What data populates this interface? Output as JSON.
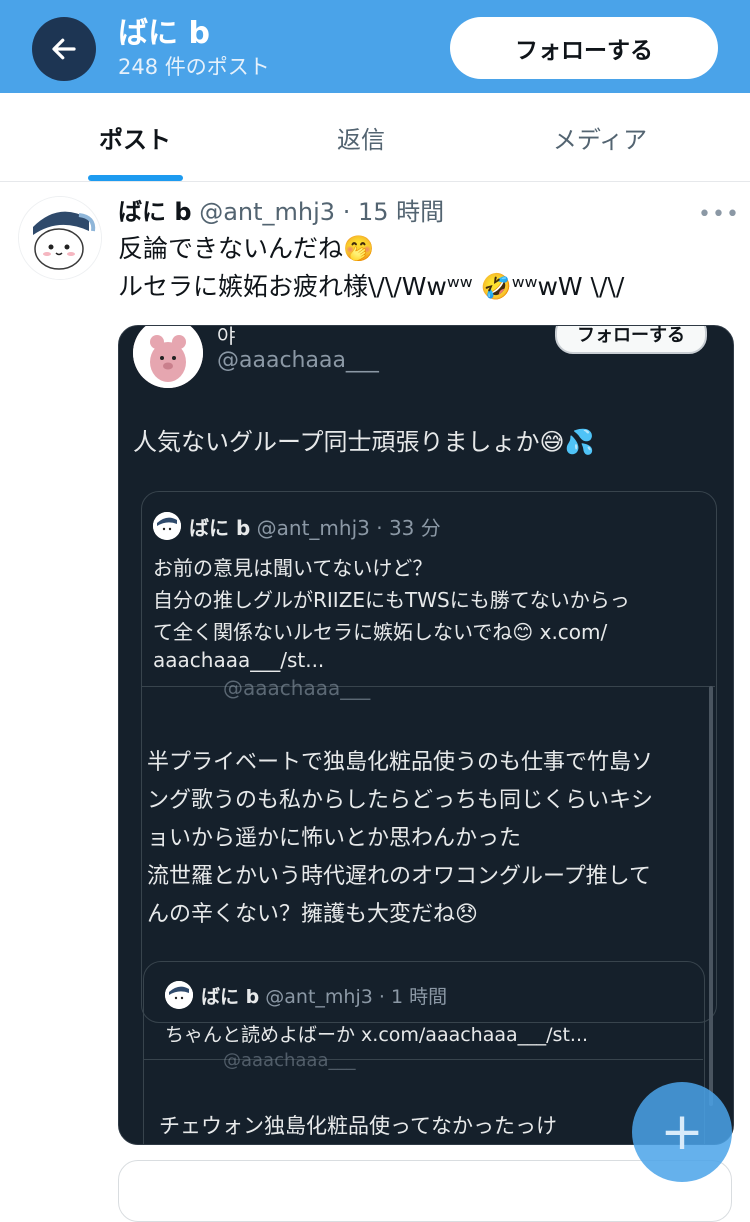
{
  "header": {
    "name": "ばに b",
    "post_count": "248 件のポスト",
    "follow_label": "フォローする",
    "colors": {
      "bar": "#4aa3e9",
      "back_circle": "#1d3553"
    }
  },
  "tabs": [
    {
      "label": "ポスト",
      "active": true
    },
    {
      "label": "返信",
      "active": false
    },
    {
      "label": "メディア",
      "active": false
    }
  ],
  "post": {
    "display_name": "ばに b",
    "handle": "@ant_mhj3",
    "time": "15 時間",
    "line1": "反論できないんだね🤭",
    "line2": "ルセラに嫉妬お疲れ様\\/\\/Wwʷʷ 🤣ʷʷwW \\/\\/",
    "more_icon": "more-horizontal-icon"
  },
  "embedded": {
    "top_name": "야",
    "top_handle": "@aaachaaa___",
    "top_follow": "フォローする",
    "main_text": "人気ないグループ同士頑張りましょか😅💦",
    "quote1": {
      "name": "ばに b",
      "handle": "@ant_mhj3",
      "time": "33 分",
      "l1": "お前の意見は聞いてないけど？",
      "l2": "自分の推しグルがRIIZEにもTWSにも勝てないからっ",
      "l3": "て全く関係ないルセラに嫉妬しないでね😊 x.com/",
      "l4": "aaachaaa___/st..."
    },
    "cut_handle": "@aaachaaa___",
    "body": {
      "l1": "半プライベートで独島化粧品使うのも仕事で竹島ソ",
      "l2": "ング歌うのも私からしたらどっちも同じくらいキシ",
      "l3": "ョいから遥かに怖いとか思わんかった",
      "l4": "流世羅とかいう時代遅れのオワコングループ推して",
      "l5": "んの辛くない？擁護も大変だね😞"
    },
    "quote2": {
      "name": "ばに b",
      "handle": "@ant_mhj3",
      "time": "1 時間",
      "l1": "ちゃんと読めよばーか x.com/aaachaaa___/st..."
    },
    "cut_handle2": "@aaachaaa___",
    "bottom": "チェウォン独島化粧品使ってなかったっけ"
  },
  "fab": {
    "label": "+"
  }
}
